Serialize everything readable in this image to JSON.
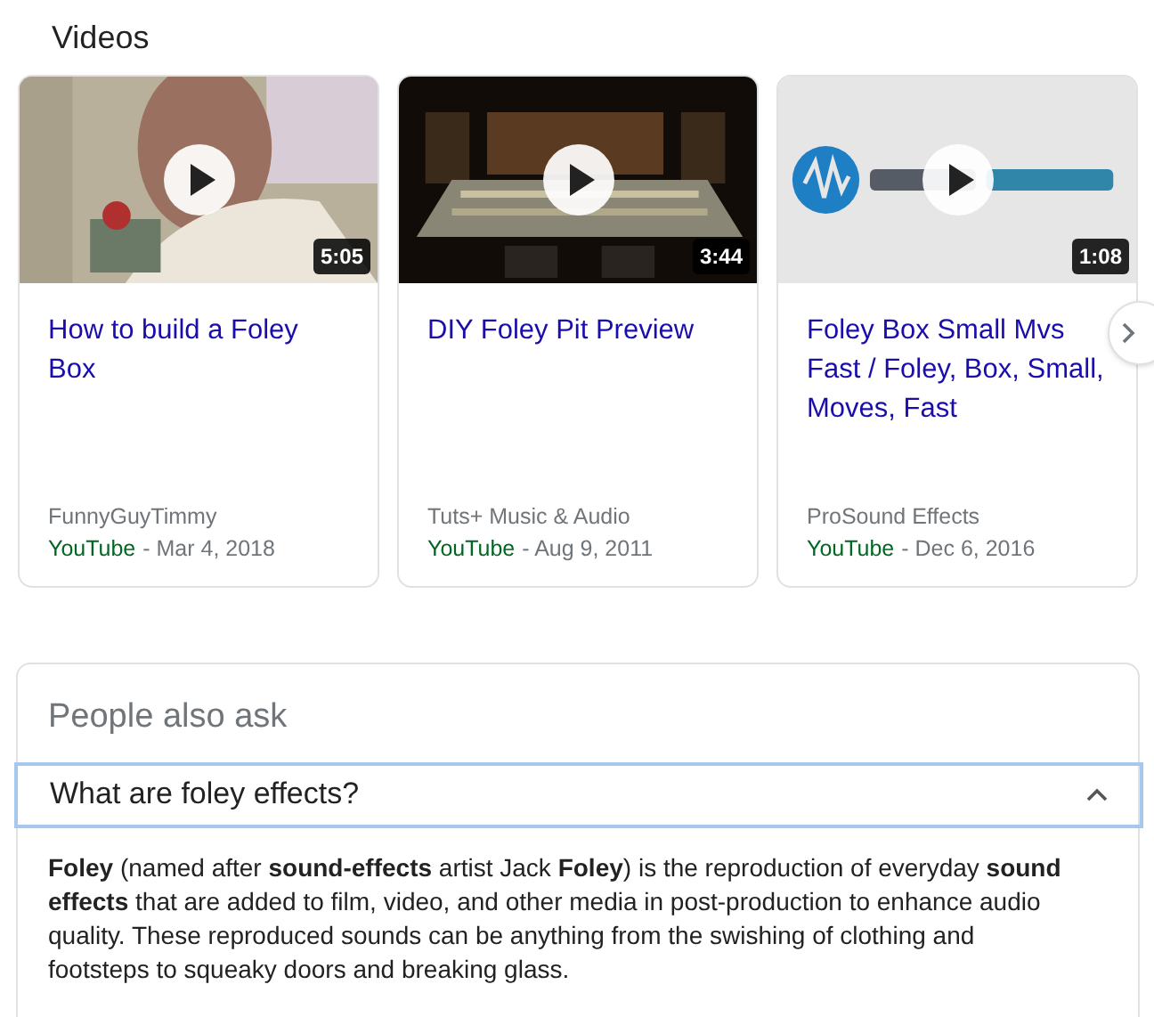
{
  "section_title": "Videos",
  "videos": [
    {
      "title": "How to build a Foley Box",
      "duration": "5:05",
      "channel": "FunnyGuyTimmy",
      "source": "YouTube",
      "date": "- Mar 4, 2018",
      "kind": "room"
    },
    {
      "title": "DIY Foley Pit Preview",
      "duration": "3:44",
      "channel": "Tuts+ Music & Audio",
      "source": "YouTube",
      "date": "- Aug 9, 2011",
      "kind": "studio"
    },
    {
      "title": "Foley Box Small Mvs Fast / Foley, Box, Small, Moves, Fast",
      "duration": "1:08",
      "channel": "ProSound Effects",
      "source": "YouTube",
      "date": "- Dec 6, 2016",
      "kind": "logo"
    }
  ],
  "people_also_ask": {
    "title": "People also ask",
    "questions": [
      {
        "question": "What are foley effects?",
        "expanded": true,
        "answer": "**Foley** (named after **sound-effects** artist Jack **Foley**) is the reproduction of everyday **sound effects** that are added to film, video, and other media in post-production to enhance audio quality. These reproduced sounds can be anything from the swishing of clothing and footsteps to squeaky doors and breaking glass."
      }
    ]
  }
}
